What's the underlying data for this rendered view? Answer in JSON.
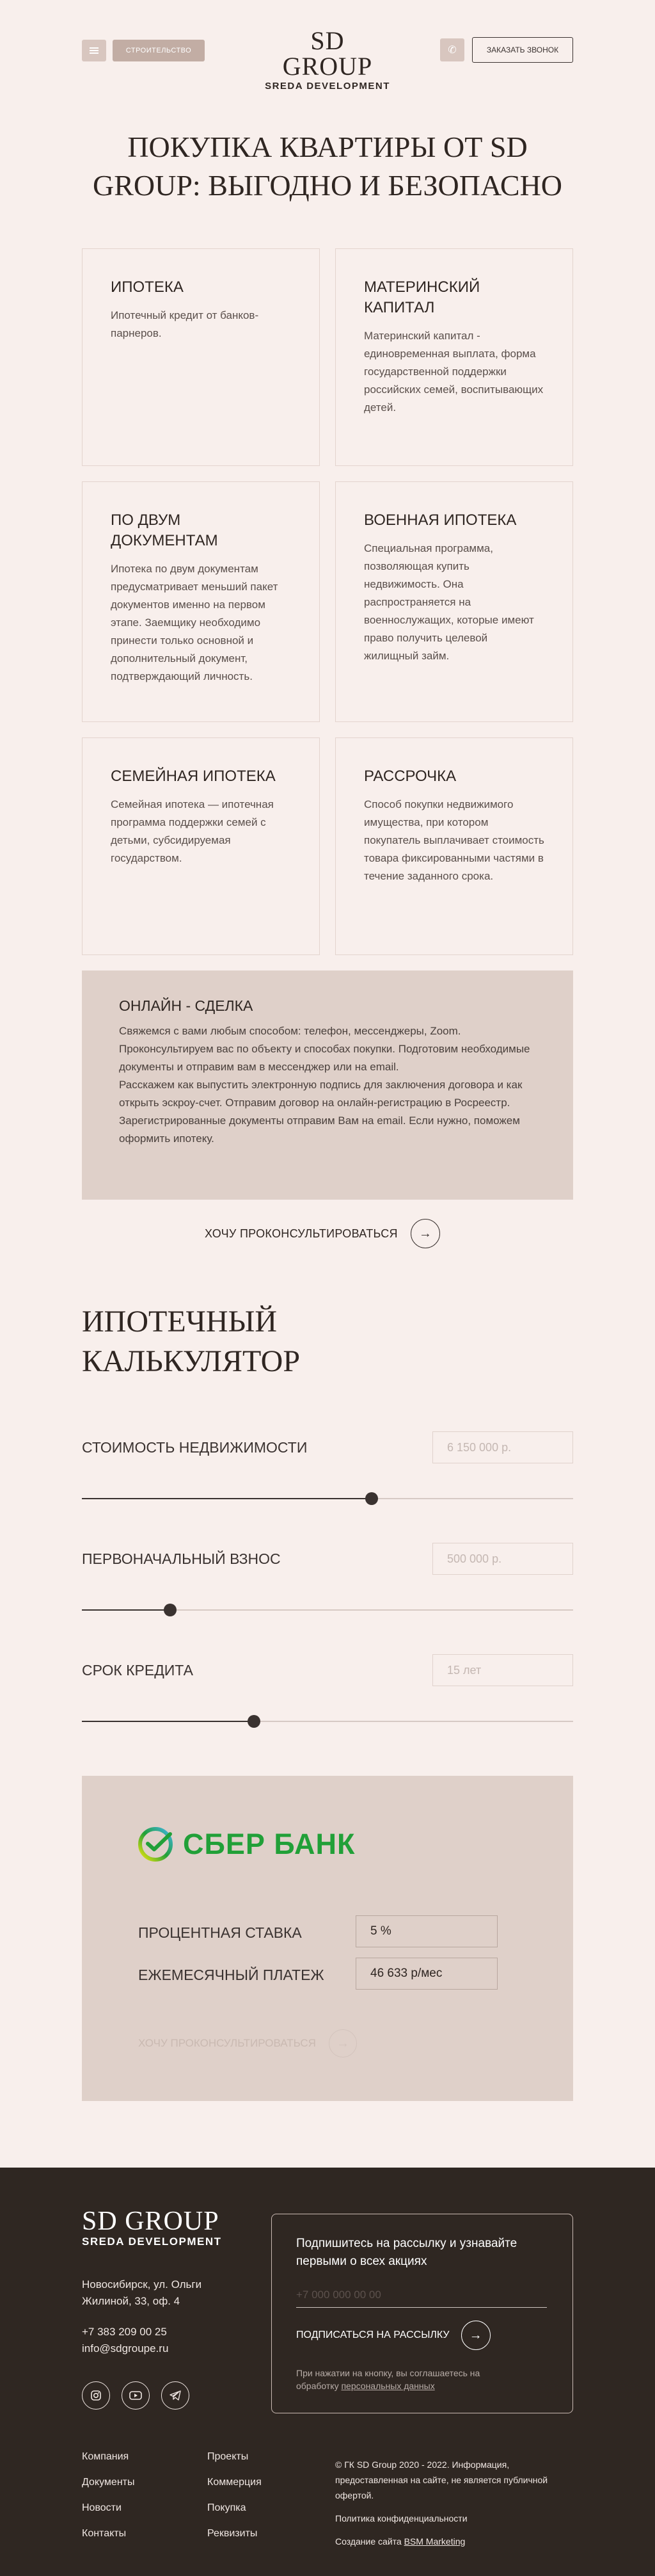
{
  "header": {
    "category_label": "строительство",
    "logo_main": "SD GROUP",
    "logo_sub": "SREDA DEVELOPMENT",
    "call_label": "заказать звонок"
  },
  "page_title": "ПОКУПКА КВАРТИРЫ ОТ SD GROUP: ВЫГОДНО И БЕЗОПАСНО",
  "cards": [
    {
      "title": "ИПОТЕКА",
      "text": "Ипотечный кредит от банков-парнеров."
    },
    {
      "title": "МАТЕРИНСКИЙ КАПИТАЛ",
      "text": "Материнский капитал - единовременная выплата, форма государственной поддержки российских семей, воспитывающих детей."
    },
    {
      "title": "ПО ДВУМ ДОКУМЕНТАМ",
      "text": "Ипотека по двум документам предусматривает меньший пакет документов именно на первом этапе. Заемщику необходимо принести только основной и дополнительный документ, подтверждающий личность."
    },
    {
      "title": "ВОЕННАЯ ИПОТЕКА",
      "text": "Специальная программа, позволяющая купить недвижимость. Она распространяется на военнослужащих, которые имеют право получить целевой жилищный займ."
    },
    {
      "title": "СЕМЕЙНАЯ ИПОТЕКА",
      "text": "Семейная ипотека — ипотечная программа поддержки семей с детьми, субсидируемая государством."
    },
    {
      "title": "РАССРОЧКА",
      "text": "Способ покупки недвижимого имущества, при котором покупатель выплачивает стоимость товара фиксированными частями в течение заданного срока."
    }
  ],
  "online": {
    "title": "ОНЛАЙН - СДЕЛКА",
    "text": "Свяжемся с вами любым способом: телефон, мессенджеры, Zoom.\nПроконсультируем вас по объекту  и способах покупки. Подготовим необходимые документы и отправим вам в мессенджер или на email.\nРасскажем как  выпустить электронную подпись для заключения договора и как открыть эскроу-счет. Отправим договор на онлайн-регистрацию в Росреестр.\nЗарегистрированные документы отправим Вам на email. Если нужно, поможем оформить ипотеку."
  },
  "consult_label": "ХОЧУ ПРОКОНСУЛЬТИРОВАТЬСЯ",
  "calculator": {
    "title": "ИПОТЕЧНЫЙ КАЛЬКУЛЯТОР",
    "price": {
      "label": "СТОИМОСТЬ НЕДВИЖИМОСТИ",
      "value": "6 150 000 р.",
      "fill_fraction": 0.59
    },
    "down_payment": {
      "label": "ПЕРВОНАЧАЛЬНЫЙ ВЗНОС",
      "value": "500 000 р.",
      "fill_fraction": 0.18
    },
    "term": {
      "label": "СРОК КРЕДИТА",
      "value": "15 лет",
      "fill_fraction": 0.35
    }
  },
  "bank": {
    "name": "СБЕР БАНК",
    "rate_label": "ПРОЦЕНТНАЯ СТАВКА",
    "rate_value": "5 %",
    "payment_label": "ЕЖЕМЕСЯЧНЫЙ ПЛАТЕЖ",
    "payment_value": "46 633 р/мес",
    "consult_label": "ХОЧУ ПРОКОНСУЛЬТИРОВАТЬСЯ"
  },
  "footer": {
    "logo_main": "SD GROUP",
    "logo_sub": "SREDA DEVELOPMENT",
    "address_line1": "Новосибирск, ул. Ольги",
    "address_line2": "Жилиной, 33, оф. 4",
    "phone": "+7 383 209 00 25",
    "email": "info@sdgroupe.ru",
    "subscribe_title": "Подпишитесь на рассылку и узнавайте первыми о всех акциях",
    "subscribe_placeholder": "+7 000 000 00 00",
    "subscribe_button": "ПОДПИСАТЬСЯ НА РАССЫЛКУ",
    "subscribe_note": "При нажатии на кнопку, вы соглашаетесь на обработку",
    "subscribe_note_link": "персональных данных",
    "links_col1": [
      "Компания",
      "Документы",
      "Новости",
      "Контакты"
    ],
    "links_col2": [
      "Проекты",
      "Коммерция",
      "Покупка",
      "Реквизиты"
    ],
    "copyright": "© ГК SD Group 2020 - 2022. Информация, предоставленная на сайте, не является публичной офертой.",
    "privacy": "Политика конфиденциальности",
    "made_by_prefix": "Создание сайта",
    "made_by_link": "BSM Marketing"
  }
}
